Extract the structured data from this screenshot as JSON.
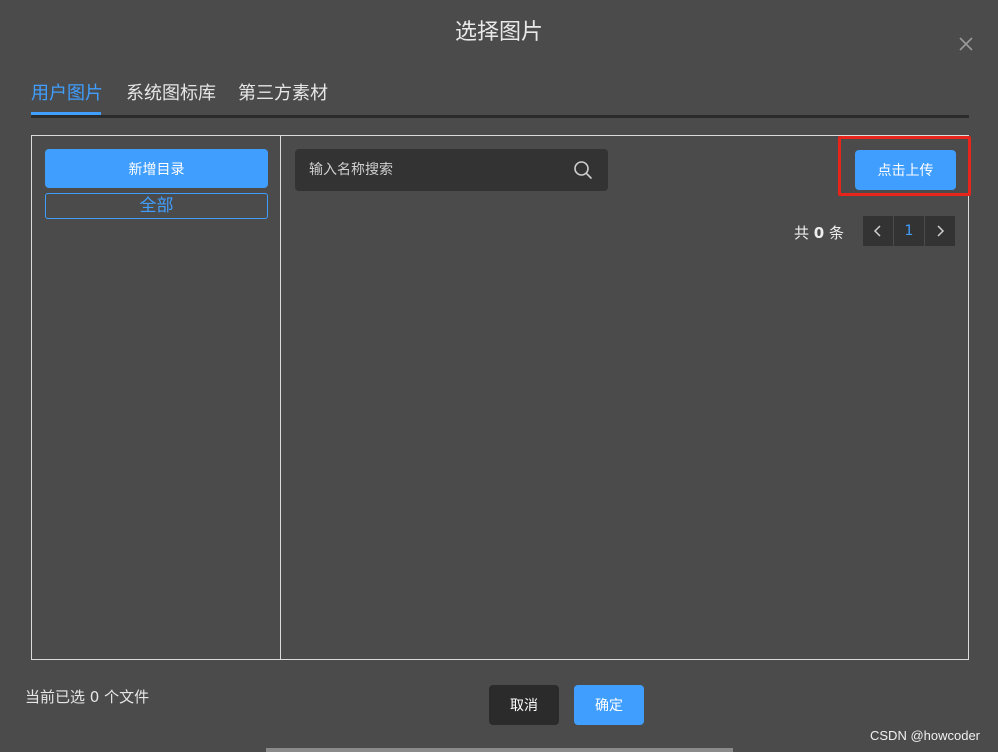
{
  "dialog": {
    "title": "选择图片"
  },
  "tabs": [
    {
      "label": "用户图片",
      "active": true
    },
    {
      "label": "系统图标库",
      "active": false
    },
    {
      "label": "第三方素材",
      "active": false
    }
  ],
  "sidebar": {
    "new_dir_label": "新增目录",
    "all_label": "全部"
  },
  "search": {
    "placeholder": "输入名称搜索",
    "value": ""
  },
  "upload": {
    "label": "点击上传"
  },
  "pagination": {
    "total_prefix": "共",
    "total": "0",
    "total_suffix": "条",
    "current_page": "1"
  },
  "footer": {
    "selected_info": "当前已选 0 个文件",
    "cancel_label": "取消",
    "confirm_label": "确定"
  },
  "watermark": "CSDN @howcoder",
  "colors": {
    "accent": "#409eff",
    "background": "#4b4b4b",
    "highlight": "#e8241b"
  },
  "icons": {
    "close": "close-icon",
    "search": "search-icon",
    "prev": "chevron-left-icon",
    "next": "chevron-right-icon"
  }
}
